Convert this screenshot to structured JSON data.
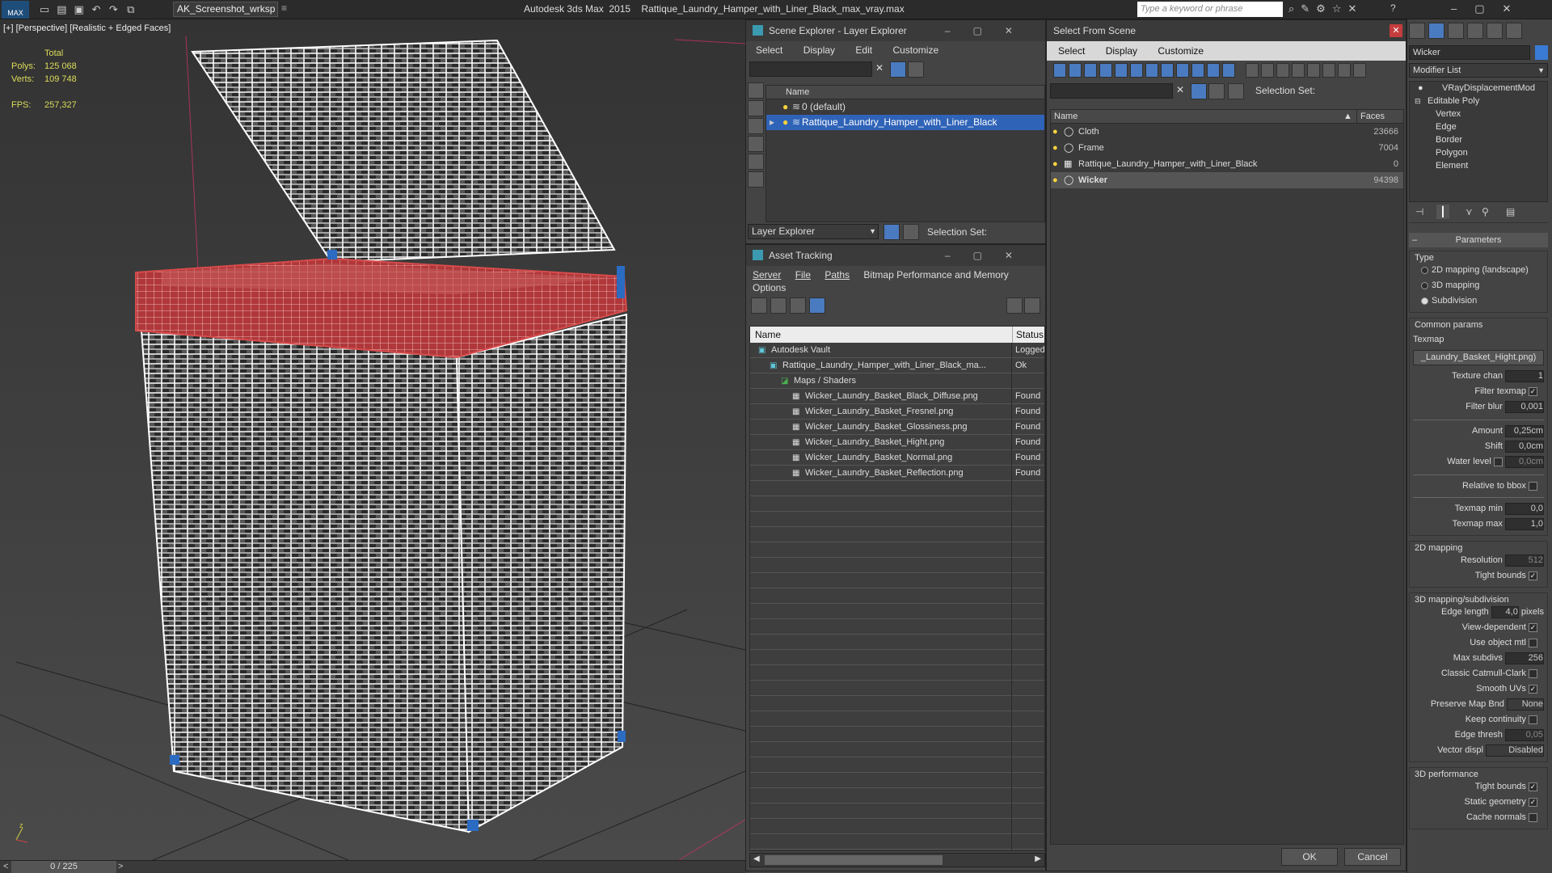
{
  "app": {
    "title": "Autodesk 3ds Max  2015    Rattique_Laundry_Hamper_with_Liner_Black_max_vray.max",
    "workspace": "AK_Screenshot_wrksp",
    "search_placeholder": "Type a keyword or phrase"
  },
  "viewport": {
    "label": "[+] [Perspective] [Realistic + Edged Faces]",
    "stats": {
      "total_label": "Total",
      "polys_label": "Polys:",
      "polys": "125 068",
      "verts_label": "Verts:",
      "verts": "109 748",
      "fps_label": "FPS:",
      "fps": "257,327"
    },
    "timeline": "0 / 225",
    "prev": "<",
    "next": ">"
  },
  "scene_explorer": {
    "title": "Scene Explorer - Layer Explorer",
    "menu": [
      "Select",
      "Display",
      "Edit",
      "Customize"
    ],
    "column": "Name",
    "rows": [
      {
        "label": "0 (default)",
        "selected": false
      },
      {
        "label": "Rattique_Laundry_Hamper_with_Liner_Black",
        "selected": true
      }
    ],
    "footer_dropdown": "Layer Explorer",
    "selection_set": "Selection Set:"
  },
  "asset_tracking": {
    "title": "Asset Tracking",
    "menu": [
      "Server",
      "File",
      "Paths",
      "Bitmap Performance and Memory",
      "Options"
    ],
    "columns": [
      "Name",
      "Status"
    ],
    "rows": [
      {
        "name": "Autodesk Vault",
        "status": "Logged",
        "indent": 0
      },
      {
        "name": "Rattique_Laundry_Hamper_with_Liner_Black_ma...",
        "status": "Ok",
        "indent": 1
      },
      {
        "name": "Maps / Shaders",
        "status": "",
        "indent": 2
      },
      {
        "name": "Wicker_Laundry_Basket_Black_Diffuse.png",
        "status": "Found",
        "indent": 3
      },
      {
        "name": "Wicker_Laundry_Basket_Fresnel.png",
        "status": "Found",
        "indent": 3
      },
      {
        "name": "Wicker_Laundry_Basket_Glossiness.png",
        "status": "Found",
        "indent": 3
      },
      {
        "name": "Wicker_Laundry_Basket_Hight.png",
        "status": "Found",
        "indent": 3
      },
      {
        "name": "Wicker_Laundry_Basket_Normal.png",
        "status": "Found",
        "indent": 3
      },
      {
        "name": "Wicker_Laundry_Basket_Reflection.png",
        "status": "Found",
        "indent": 3
      }
    ]
  },
  "select_from_scene": {
    "title": "Select From Scene",
    "menu": [
      "Select",
      "Display",
      "Customize"
    ],
    "selection_set": "Selection Set:",
    "columns": [
      "Name",
      "Faces"
    ],
    "rows": [
      {
        "name": "Cloth",
        "faces": "23666",
        "selected": false
      },
      {
        "name": "Frame",
        "faces": "7004",
        "selected": false
      },
      {
        "name": "Rattique_Laundry_Hamper_with_Liner_Black",
        "faces": "0",
        "selected": false
      },
      {
        "name": "Wicker",
        "faces": "94398",
        "selected": true
      }
    ],
    "ok": "OK",
    "cancel": "Cancel"
  },
  "command_panel": {
    "object_name": "Wicker",
    "modifier_list": "Modifier List",
    "stack": [
      "VRayDisplacementMod",
      "Editable Poly",
      "Vertex",
      "Edge",
      "Border",
      "Polygon",
      "Element"
    ],
    "rollout": "Parameters",
    "type_label": "Type",
    "types": [
      {
        "label": "2D mapping (landscape)",
        "on": false
      },
      {
        "label": "3D mapping",
        "on": false
      },
      {
        "label": "Subdivision",
        "on": true
      }
    ],
    "common_params": "Common params",
    "texmap_label": "Texmap",
    "texmap_value": "_Laundry_Basket_Hight.png)",
    "texture_chan_label": "Texture chan",
    "texture_chan": "1",
    "filter_texmap": "Filter texmap",
    "filter_blur_label": "Filter blur",
    "filter_blur": "0,001",
    "amount_label": "Amount",
    "amount": "0,25cm",
    "shift_label": "Shift",
    "shift": "0,0cm",
    "water_level_label": "Water level",
    "water_level": "0,0cm",
    "relative_bbox": "Relative to bbox",
    "texmap_min_label": "Texmap min",
    "texmap_min": "0,0",
    "texmap_max_label": "Texmap max",
    "texmap_max": "1,0",
    "mapping2d": "2D mapping",
    "resolution_label": "Resolution",
    "resolution": "512",
    "tight_bounds": "Tight bounds",
    "mapping3d": "3D mapping/subdivision",
    "edge_length_label": "Edge length",
    "edge_length": "4,0",
    "pixels": "pixels",
    "view_dependent": "View-dependent",
    "use_object_mtl": "Use object mtl",
    "max_subdivs_label": "Max subdivs",
    "max_subdivs": "256",
    "classic_catmull": "Classic Catmull-Clark",
    "smooth_uvs": "Smooth UVs",
    "preserve_map_label": "Preserve Map Bnd",
    "preserve_map": "None",
    "keep_continuity": "Keep continuity",
    "edge_thresh_label": "Edge thresh",
    "edge_thresh": "0,05",
    "vector_displ_label": "Vector displ",
    "vector_displ": "Disabled",
    "performance": "3D performance",
    "tight_bounds2": "Tight bounds",
    "static_geometry": "Static geometry",
    "cache_normals": "Cache normals"
  }
}
